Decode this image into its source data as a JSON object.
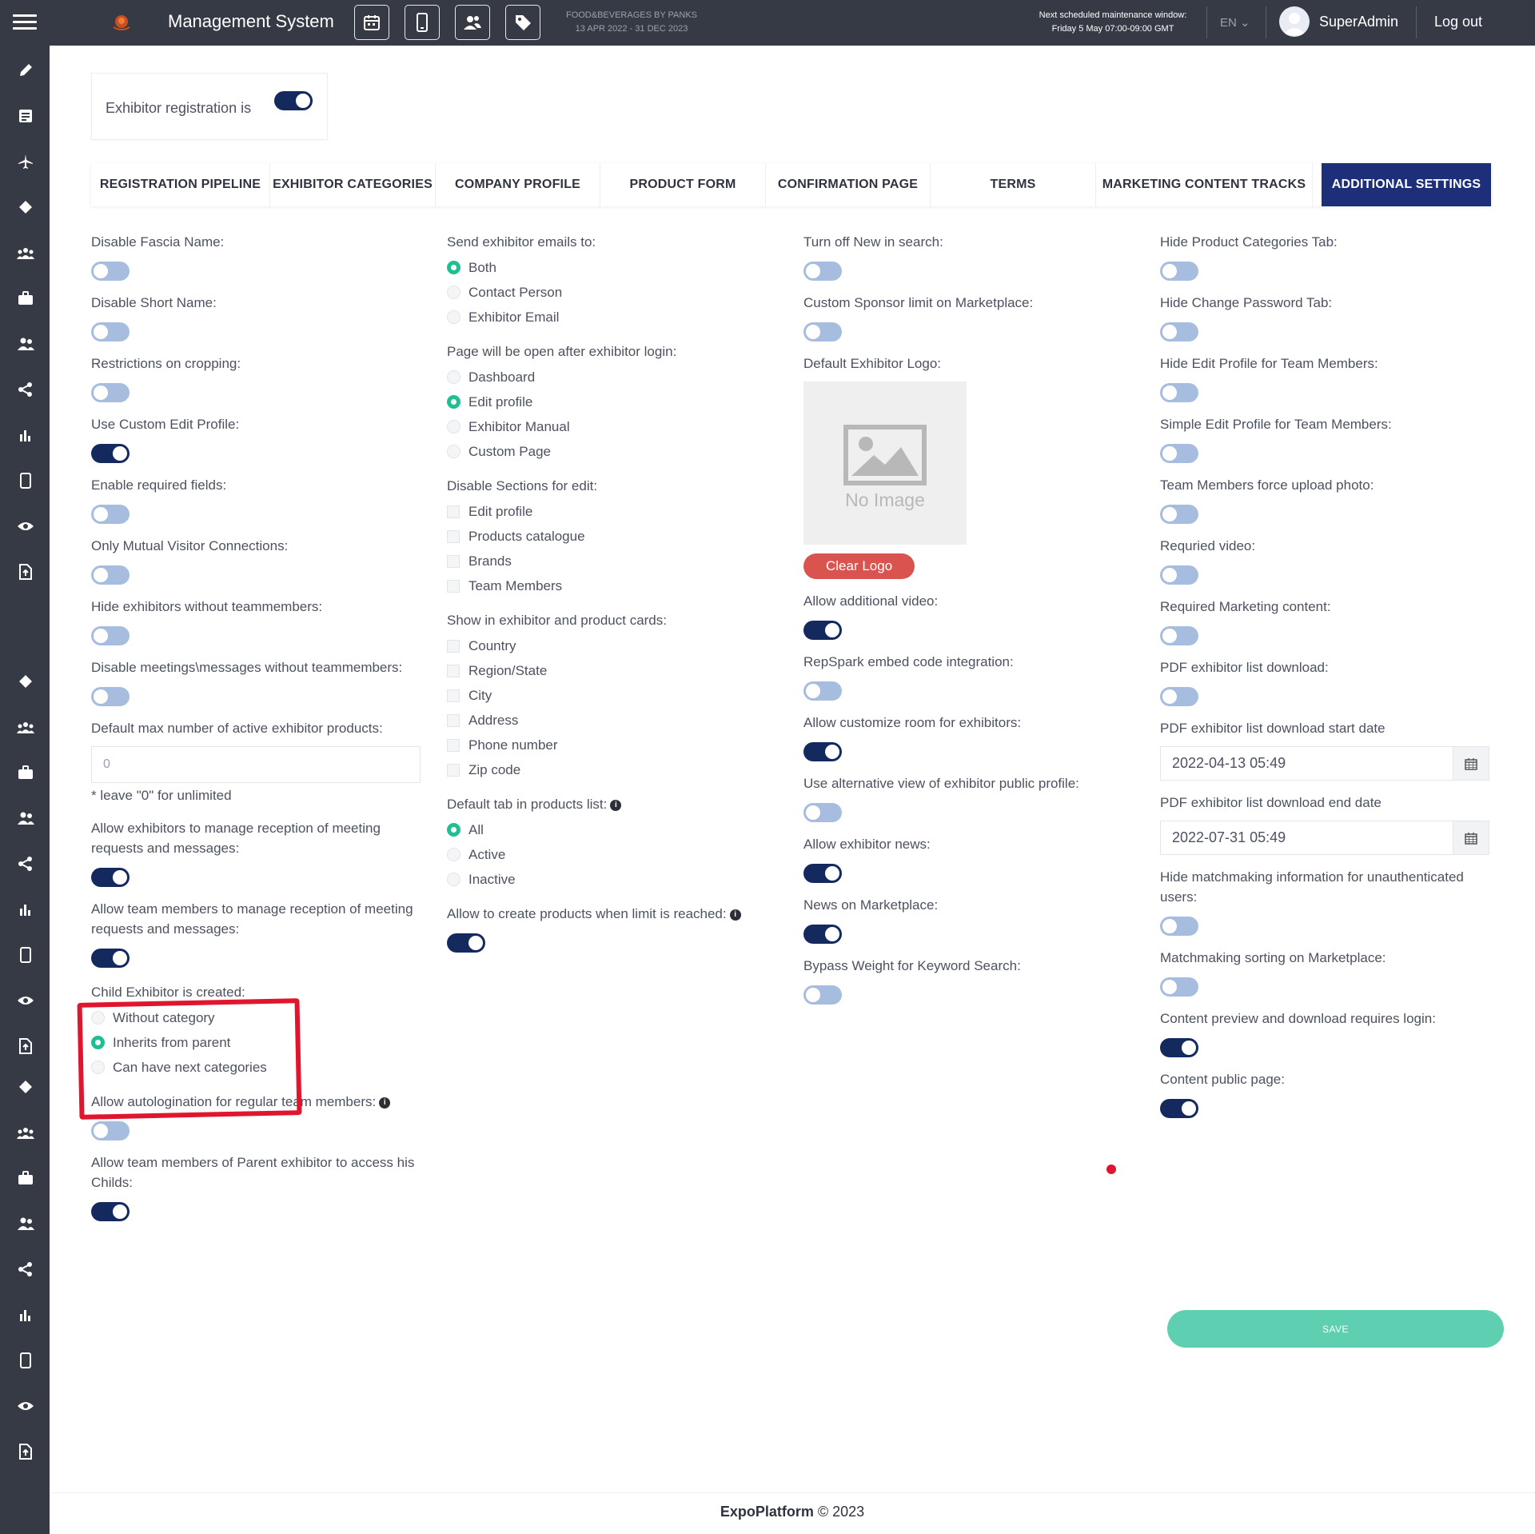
{
  "header": {
    "app_title": "Management System",
    "event_name": "FOOD&BEVERAGES BY PANKS",
    "event_dates": "13 APR 2022 - 31 DEC 2023",
    "maintenance_line1": "Next scheduled maintenance window:",
    "maintenance_line2": "Friday 5 May 07:00-09:00 GMT",
    "language": "EN",
    "username": "SuperAdmin",
    "logout": "Log out"
  },
  "registration": {
    "label": "Exhibitor registration is",
    "enabled": true
  },
  "tabs": [
    {
      "label": "REGISTRATION PIPELINE",
      "active": false
    },
    {
      "label": "EXHIBITOR CATEGORIES",
      "active": false
    },
    {
      "label": "COMPANY PROFILE",
      "active": false
    },
    {
      "label": "PRODUCT FORM",
      "active": false
    },
    {
      "label": "CONFIRMATION PAGE",
      "active": false
    },
    {
      "label": "TERMS",
      "active": false
    },
    {
      "label": "MARKETING CONTENT TRACKS",
      "active": false
    },
    {
      "label": "ADDITIONAL SETTINGS",
      "active": true
    }
  ],
  "col1": {
    "disable_fascia": "Disable Fascia Name:",
    "disable_short": "Disable Short Name:",
    "restrictions_cropping": "Restrictions on cropping:",
    "custom_edit_profile": "Use Custom Edit Profile:",
    "required_fields": "Enable required fields:",
    "mutual_connections": "Only Mutual Visitor Connections:",
    "hide_without_team": "Hide exhibitors without teammembers:",
    "disable_meetings": "Disable meetings\\messages without teammembers:",
    "max_products_label": "Default max number of active exhibitor products:",
    "max_products_placeholder": "0",
    "max_products_hint": "* leave \"0\" for unlimited",
    "allow_exhibitors_manage": "Allow exhibitors to manage reception of meeting requests and messages:",
    "allow_team_manage": "Allow team members to manage reception of meeting requests and messages:",
    "child_label": "Child Exhibitor is created:",
    "child_opt1": "Without category",
    "child_opt2": "Inherits from parent",
    "child_opt3": "Can have next categories",
    "autologin": "Allow autologination for regular team members:",
    "parent_access": "Allow team members of Parent exhibitor to access his Childs:"
  },
  "col2": {
    "send_emails_label": "Send exhibitor emails to:",
    "send_opt1": "Both",
    "send_opt2": "Contact Person",
    "send_opt3": "Exhibitor Email",
    "page_after_login": "Page will be open after exhibitor login:",
    "page_opt1": "Dashboard",
    "page_opt2": "Edit profile",
    "page_opt3": "Exhibitor Manual",
    "page_opt4": "Custom Page",
    "disable_sections": "Disable Sections for edit:",
    "sec_opt1": "Edit profile",
    "sec_opt2": "Products catalogue",
    "sec_opt3": "Brands",
    "sec_opt4": "Team Members",
    "show_in_cards": "Show in exhibitor and product cards:",
    "card_opt1": "Country",
    "card_opt2": "Region/State",
    "card_opt3": "City",
    "card_opt4": "Address",
    "card_opt5": "Phone number",
    "card_opt6": "Zip code",
    "default_tab": "Default tab in products list:",
    "tab_opt1": "All",
    "tab_opt2": "Active",
    "tab_opt3": "Inactive",
    "allow_create_products": "Allow to create products when limit is reached:"
  },
  "col3": {
    "turn_off_new": "Turn off New in search:",
    "custom_sponsor": "Custom Sponsor limit on Marketplace:",
    "default_logo": "Default Exhibitor Logo:",
    "no_image": "No Image",
    "clear_logo": "Clear Logo",
    "additional_video": "Allow additional video:",
    "repspark": "RepSpark embed code integration:",
    "customize_room": "Allow customize room for exhibitors:",
    "alternative_view": "Use alternative view of exhibitor public profile:",
    "exhibitor_news": "Allow exhibitor news:",
    "news_marketplace": "News on Marketplace:",
    "bypass_weight": "Bypass Weight for Keyword Search:"
  },
  "col4": {
    "hide_product_categories": "Hide Product Categories Tab:",
    "hide_change_password": "Hide Change Password Tab:",
    "hide_edit_profile_team": "Hide Edit Profile for Team Members:",
    "simple_edit_profile": "Simple Edit Profile for Team Members:",
    "force_upload_photo": "Team Members force upload photo:",
    "required_video": "Requried video:",
    "required_marketing": "Required Marketing content:",
    "pdf_download": "PDF exhibitor list download:",
    "pdf_start_label": "PDF exhibitor list download start date",
    "pdf_start_value": "2022-04-13 05:49",
    "pdf_end_label": "PDF exhibitor list download end date",
    "pdf_end_value": "2022-07-31 05:49",
    "hide_matchmaking": "Hide matchmaking information for unauthenticated users:",
    "matchmaking_sorting": "Matchmaking sorting on Marketplace:",
    "content_preview_login": "Content preview and download requires login:",
    "content_public_page": "Content public page:"
  },
  "save_label": "SAVE",
  "footer": {
    "brand": "ExpoPlatform",
    "copyright": " © 2023"
  },
  "colors": {
    "accent": "#1e2f7a",
    "toggle_on": "#14295d",
    "toggle_off": "#a7bde0",
    "radio_on": "#1fbf93",
    "save": "#5ecfb1",
    "danger": "#d9534f"
  }
}
